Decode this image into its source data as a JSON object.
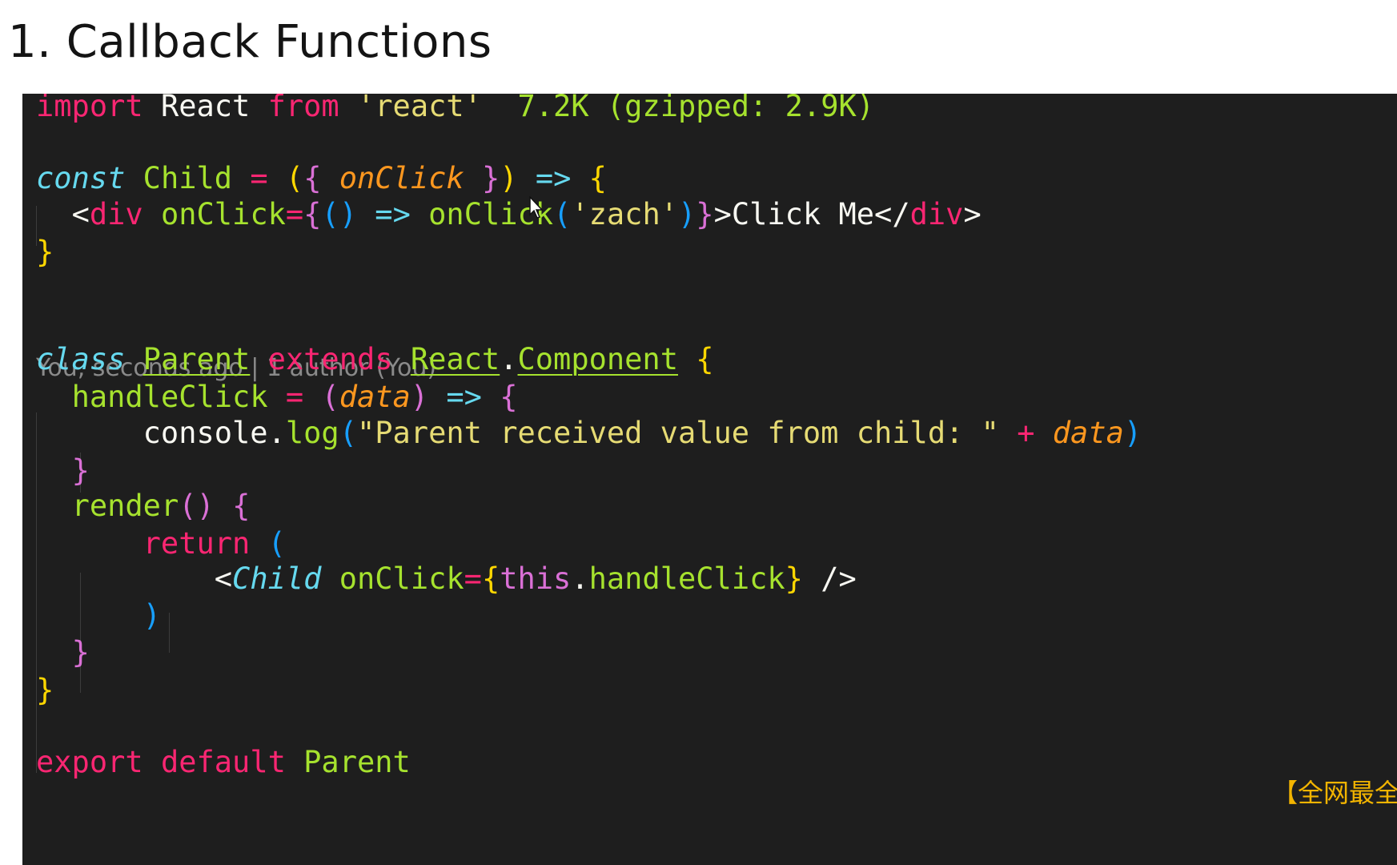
{
  "slide": {
    "title": "1. Callback Functions"
  },
  "editor": {
    "blame": "You, seconds ago | 1 author (You)",
    "watermark": "【全网最全",
    "colors": {
      "background": "#1e1e1e",
      "keyword": "#f92672",
      "function": "#a6e22e",
      "string": "#e6db74",
      "storage": "#66d9ef",
      "parameter": "#fd971f",
      "text": "#f8f8f2"
    },
    "lines": [
      [
        {
          "t": "import",
          "c": "kw"
        },
        {
          "t": " ",
          "c": "plain"
        },
        {
          "t": "React",
          "c": "plain"
        },
        {
          "t": " ",
          "c": "plain"
        },
        {
          "t": "from",
          "c": "kw"
        },
        {
          "t": " ",
          "c": "plain"
        },
        {
          "t": "'react'",
          "c": "str"
        },
        {
          "t": "  ",
          "c": "plain"
        },
        {
          "t": "7.2K (gzipped: 2.9K)",
          "c": "comment-size"
        }
      ],
      [],
      [
        {
          "t": "const",
          "c": "storage"
        },
        {
          "t": " ",
          "c": "plain"
        },
        {
          "t": "Child",
          "c": "fn"
        },
        {
          "t": " ",
          "c": "plain"
        },
        {
          "t": "=",
          "c": "op"
        },
        {
          "t": " ",
          "c": "plain"
        },
        {
          "t": "(",
          "c": "bracket-y"
        },
        {
          "t": "{",
          "c": "bracket-p"
        },
        {
          "t": " ",
          "c": "plain"
        },
        {
          "t": "onClick",
          "c": "param"
        },
        {
          "t": " ",
          "c": "plain"
        },
        {
          "t": "}",
          "c": "bracket-p"
        },
        {
          "t": ")",
          "c": "bracket-y"
        },
        {
          "t": " ",
          "c": "plain"
        },
        {
          "t": "=>",
          "c": "arrow"
        },
        {
          "t": " ",
          "c": "plain"
        },
        {
          "t": "{",
          "c": "bracket-y"
        }
      ],
      [
        {
          "t": "  ",
          "c": "plain"
        },
        {
          "t": "<",
          "c": "plain"
        },
        {
          "t": "div",
          "c": "kw"
        },
        {
          "t": " ",
          "c": "plain"
        },
        {
          "t": "onClick",
          "c": "fn"
        },
        {
          "t": "=",
          "c": "op"
        },
        {
          "t": "{",
          "c": "bracket-p"
        },
        {
          "t": "()",
          "c": "bracket-b"
        },
        {
          "t": " ",
          "c": "plain"
        },
        {
          "t": "=>",
          "c": "arrow"
        },
        {
          "t": " ",
          "c": "plain"
        },
        {
          "t": "onClick",
          "c": "fn"
        },
        {
          "t": "(",
          "c": "bracket-b"
        },
        {
          "t": "'zach'",
          "c": "str"
        },
        {
          "t": ")",
          "c": "bracket-b"
        },
        {
          "t": "}",
          "c": "bracket-p"
        },
        {
          "t": ">Click Me</",
          "c": "plain"
        },
        {
          "t": "div",
          "c": "kw"
        },
        {
          "t": ">",
          "c": "plain"
        }
      ],
      [
        {
          "t": "}",
          "c": "bracket-y"
        }
      ],
      [],
      [],
      [
        {
          "t": "class",
          "c": "storage"
        },
        {
          "t": " ",
          "c": "plain"
        },
        {
          "t": "Parent",
          "c": "fn u"
        },
        {
          "t": " ",
          "c": "plain"
        },
        {
          "t": "extends",
          "c": "kw"
        },
        {
          "t": " ",
          "c": "plain"
        },
        {
          "t": "React",
          "c": "fn u"
        },
        {
          "t": ".",
          "c": "plain"
        },
        {
          "t": "Component",
          "c": "fn u"
        },
        {
          "t": " ",
          "c": "plain"
        },
        {
          "t": "{",
          "c": "bracket-y"
        }
      ],
      [
        {
          "t": "  ",
          "c": "plain"
        },
        {
          "t": "handleClick",
          "c": "fn"
        },
        {
          "t": " ",
          "c": "plain"
        },
        {
          "t": "=",
          "c": "op"
        },
        {
          "t": " ",
          "c": "plain"
        },
        {
          "t": "(",
          "c": "bracket-p"
        },
        {
          "t": "data",
          "c": "param"
        },
        {
          "t": ")",
          "c": "bracket-p"
        },
        {
          "t": " ",
          "c": "plain"
        },
        {
          "t": "=>",
          "c": "arrow"
        },
        {
          "t": " ",
          "c": "plain"
        },
        {
          "t": "{",
          "c": "bracket-p"
        }
      ],
      [
        {
          "t": "      ",
          "c": "plain"
        },
        {
          "t": "console",
          "c": "plain"
        },
        {
          "t": ".",
          "c": "plain"
        },
        {
          "t": "log",
          "c": "fn"
        },
        {
          "t": "(",
          "c": "bracket-b"
        },
        {
          "t": "\"Parent received value from child: \"",
          "c": "str"
        },
        {
          "t": " ",
          "c": "plain"
        },
        {
          "t": "+",
          "c": "op"
        },
        {
          "t": " ",
          "c": "plain"
        },
        {
          "t": "data",
          "c": "param"
        },
        {
          "t": ")",
          "c": "bracket-b"
        }
      ],
      [
        {
          "t": "  ",
          "c": "plain"
        },
        {
          "t": "}",
          "c": "bracket-p"
        }
      ],
      [
        {
          "t": "  ",
          "c": "plain"
        },
        {
          "t": "render",
          "c": "fn"
        },
        {
          "t": "()",
          "c": "bracket-p"
        },
        {
          "t": " ",
          "c": "plain"
        },
        {
          "t": "{",
          "c": "bracket-p"
        }
      ],
      [
        {
          "t": "      ",
          "c": "plain"
        },
        {
          "t": "return",
          "c": "kw"
        },
        {
          "t": " ",
          "c": "plain"
        },
        {
          "t": "(",
          "c": "bracket-b"
        }
      ],
      [
        {
          "t": "          ",
          "c": "plain"
        },
        {
          "t": "<",
          "c": "plain"
        },
        {
          "t": "Child",
          "c": "storage"
        },
        {
          "t": " ",
          "c": "plain"
        },
        {
          "t": "onClick",
          "c": "fn"
        },
        {
          "t": "=",
          "c": "op"
        },
        {
          "t": "{",
          "c": "bracket-y"
        },
        {
          "t": "this",
          "c": "bracket-p"
        },
        {
          "t": ".",
          "c": "plain"
        },
        {
          "t": "handleClick",
          "c": "fn"
        },
        {
          "t": "}",
          "c": "bracket-y"
        },
        {
          "t": " />",
          "c": "plain"
        }
      ],
      [
        {
          "t": "      ",
          "c": "plain"
        },
        {
          "t": ")",
          "c": "bracket-b"
        }
      ],
      [
        {
          "t": "  ",
          "c": "plain"
        },
        {
          "t": "}",
          "c": "bracket-p"
        }
      ],
      [
        {
          "t": "}",
          "c": "bracket-y"
        }
      ],
      [],
      [
        {
          "t": "export",
          "c": "kw"
        },
        {
          "t": " ",
          "c": "plain"
        },
        {
          "t": "default",
          "c": "kw"
        },
        {
          "t": " ",
          "c": "plain"
        },
        {
          "t": "Parent",
          "c": "fn"
        }
      ]
    ]
  }
}
